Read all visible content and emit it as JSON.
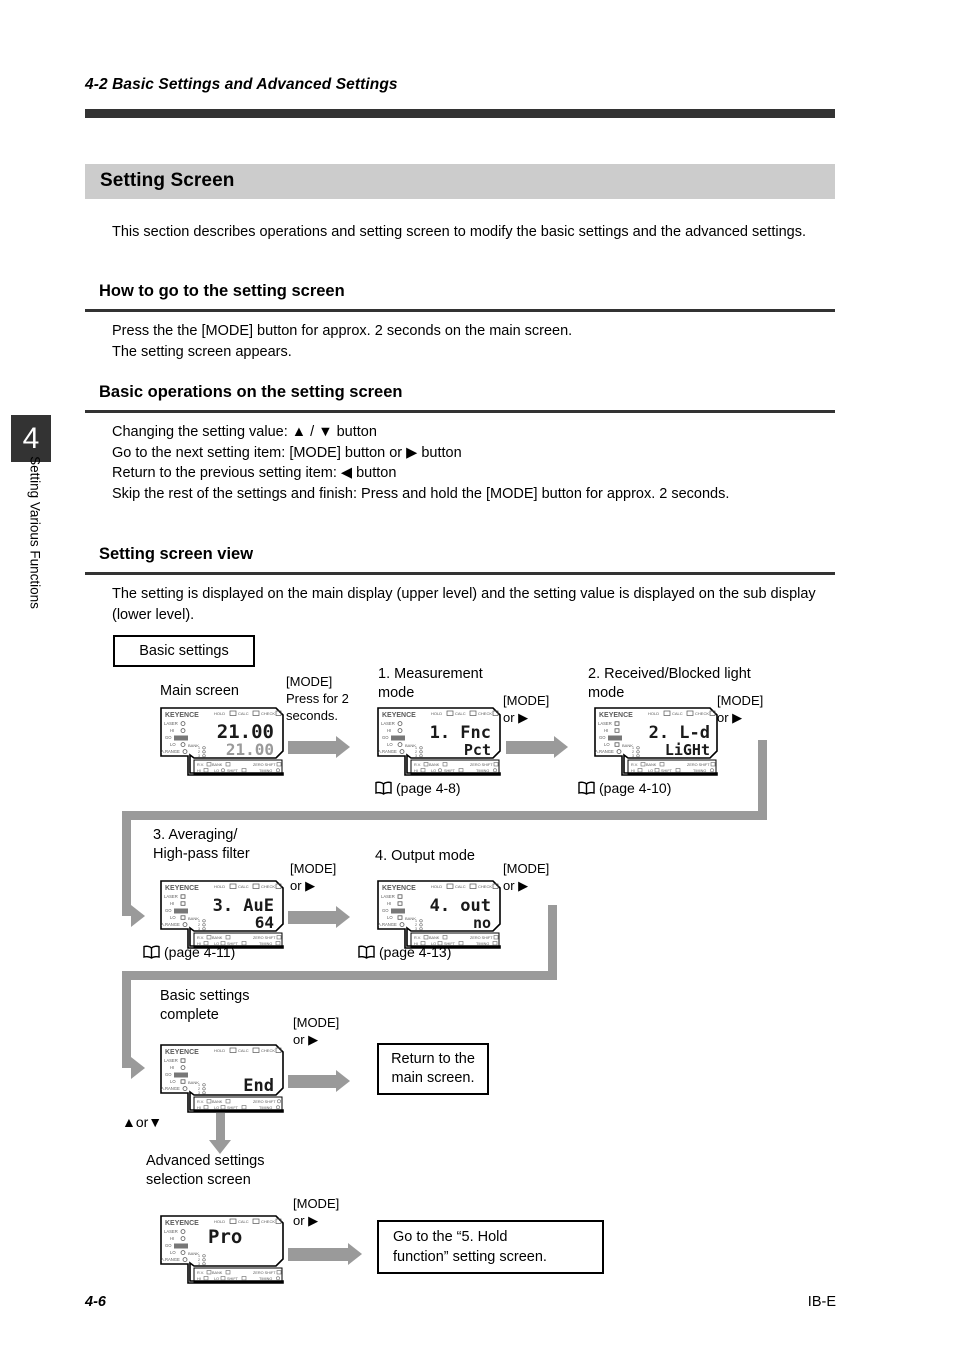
{
  "header": {
    "section_number": "4-2",
    "section_title": "Basic Settings and Advanced Settings",
    "running_head": "4-2  Basic Settings and Advanced Settings"
  },
  "chapter_tab": {
    "number": "4",
    "side_title": "Setting Various Functions"
  },
  "section": {
    "band_title": "Setting Screen",
    "intro": "This section describes operations and setting screen to modify the basic settings and the advanced settings."
  },
  "subsections": [
    {
      "heading": "How to go to the setting screen",
      "body": "Press the the [MODE] button for approx. 2 seconds on the main screen.\nThe setting screen appears."
    },
    {
      "heading": "Basic operations on the setting screen",
      "body": "Changing the setting value: ▲ / ▼ button\nGo to the next setting item: [MODE] button or ▶ button\nReturn to the previous setting item: ◀ button\nSkip the rest of the settings and finish: Press and hold the [MODE] button for approx. 2 seconds."
    },
    {
      "heading": "Setting screen view",
      "body": "The setting is displayed on the main display (upper level) and the setting value is displayed on the sub display (lower level)."
    }
  ],
  "diagram": {
    "title_box": "Basic settings",
    "steps": [
      {
        "caption": "Main screen",
        "transition": "[MODE]\nPress for 2\nseconds.",
        "display_main": "21.00",
        "display_sub": "21.00",
        "page_ref": ""
      },
      {
        "caption": "1. Measurement\n    mode",
        "transition": "[MODE]\nor ▶",
        "display_main": "1. Fnc",
        "display_sub": "Pct",
        "page_ref": "(page 4-8)"
      },
      {
        "caption": "2. Received/Blocked light\n     mode",
        "transition": "[MODE]\nor ▶",
        "display_main": "2. L-d",
        "display_sub": "LiGHt",
        "page_ref": "(page 4-10)"
      },
      {
        "caption": "3. Averaging/\n   High-pass filter",
        "transition": "[MODE]\nor ▶",
        "display_main": "3. AuE",
        "display_sub": "64",
        "page_ref": "(page 4-11)"
      },
      {
        "caption": "4. Output mode",
        "transition": "[MODE]\nor ▶",
        "display_main": "4. out",
        "display_sub": "no",
        "page_ref": "(page 4-13)"
      },
      {
        "caption": "Basic settings\ncomplete",
        "transition": "[MODE]\nor ▶",
        "display_main": "",
        "display_sub": "End",
        "page_ref": ""
      },
      {
        "caption": "Advanced settings\nselection screen",
        "transition": "[MODE]\nor ▶",
        "display_main": "Pro",
        "display_sub": "",
        "page_ref": ""
      }
    ],
    "result_boxes": [
      "Return to the\nmain screen.",
      "Go to the “5. Hold\nfunction” setting screen."
    ],
    "branch_label": "▲or▼",
    "unit_labels": {
      "brand": "KEYENCE",
      "top_indicators": [
        "HOLD",
        "CALC",
        "CHECK"
      ],
      "left_indicators": [
        "LASER",
        "HI",
        "GO",
        "LO",
        "BANK",
        "A.RANGE"
      ],
      "bottom_indicators": [
        "R.V.",
        "BANK",
        "ZERO SHIFT",
        "HI",
        "LO",
        "SHIFT",
        "TIMING"
      ]
    }
  },
  "footer": {
    "page_number": "4-6",
    "doc_code": "IB-E"
  },
  "colors": {
    "rule": "#333333",
    "band": "#cccccc",
    "connector": "#9a9a9a",
    "ink": "#000000"
  }
}
